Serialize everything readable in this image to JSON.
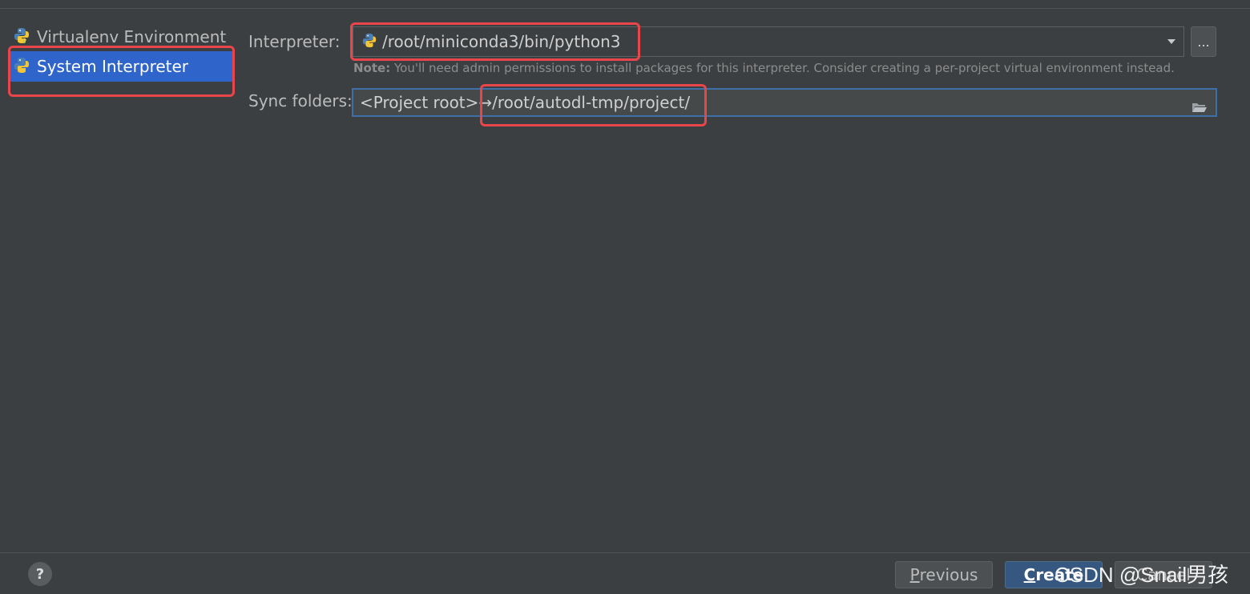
{
  "sidebar": {
    "items": [
      {
        "label": "Virtualenv Environment",
        "icon": "python-virtualenv-icon"
      },
      {
        "label": "System Interpreter",
        "icon": "python-icon",
        "selected": true
      }
    ]
  },
  "interpreter": {
    "label": "Interpreter:",
    "value": "/root/miniconda3/bin/python3",
    "browse_label": "...",
    "note_prefix": "Note:",
    "note_text": " You'll need admin permissions to install packages for this interpreter. Consider creating a per-project virtual environment instead."
  },
  "sync": {
    "label": "Sync folders:",
    "value": "<Project root>→/root/autodl-tmp/project/"
  },
  "footer": {
    "help_label": "?",
    "previous_underline": "P",
    "previous_rest": "revious",
    "create_underline": "C",
    "create_rest": "reate",
    "cancel_label": "Cancel"
  },
  "watermark": "CSDN @Snail男孩",
  "colors": {
    "background": "#3c3f41",
    "selection": "#2f65ca",
    "highlight_box": "#e8464a",
    "primary_button": "#365880",
    "focus_border": "#3d6fa8"
  }
}
